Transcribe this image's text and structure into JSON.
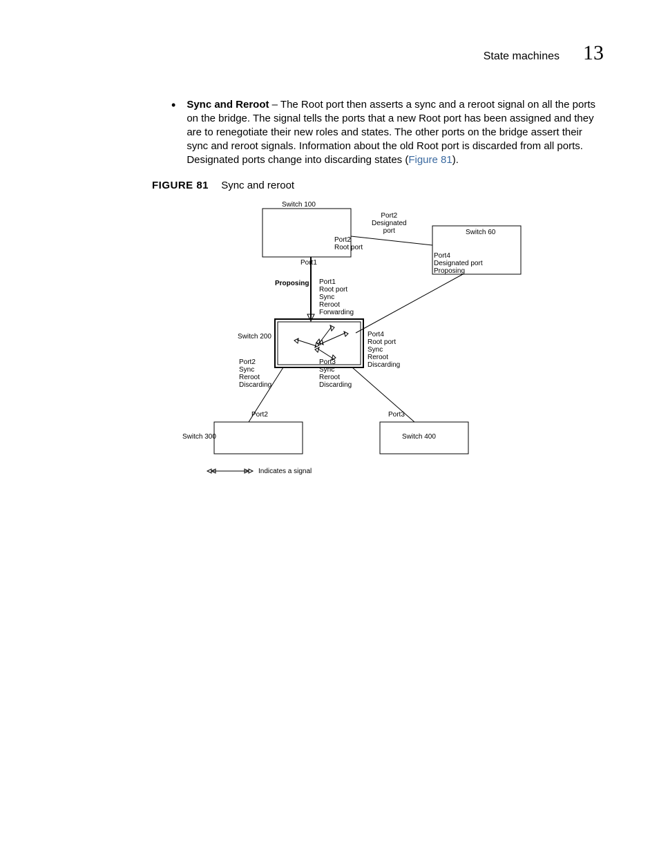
{
  "header": {
    "section_title": "State machines",
    "chapter_number": "13"
  },
  "bullet": {
    "heading": "Sync and Reroot",
    "text_before_ref": " – The Root port then asserts a sync and a reroot signal on all the ports on the bridge. The signal tells the ports that a new Root port has been assigned and they are to renegotiate their new roles and states. The other ports on the bridge assert their sync and reroot signals. Information about the old Root port is discarded from all ports. Designated ports change into discarding states (",
    "figure_ref": "Figure 81",
    "text_after_ref": ")."
  },
  "figure": {
    "label": "FIGURE 81",
    "caption": "Sync and reroot"
  },
  "diagram": {
    "switch_100": "Switch 100",
    "switch_60": "Switch 60",
    "switch_200": "Switch 200",
    "switch_300": "Switch 300",
    "switch_400": "Switch 400",
    "port2_designated_port": "Port2\nDesignated\nport",
    "port2_root_port": "Port2\nRoot port",
    "port1_top": "Port1",
    "port4_designated_proposing": "Port4\nDesignated port\nProposing",
    "proposing": "Proposing",
    "port1_block": "Port1\nRoot port\nSync\nReroot\nForwarding",
    "port4_block": "Port4\nRoot port\nSync\nReroot\nDiscarding",
    "port2_block": "Port2\nSync\nReroot\nDiscarding",
    "port3_block": "Port3\nSync\nReroot\nDiscarding",
    "port2_btm": "Port2",
    "port3_btm": "Port3",
    "legend": "Indicates a signal"
  }
}
